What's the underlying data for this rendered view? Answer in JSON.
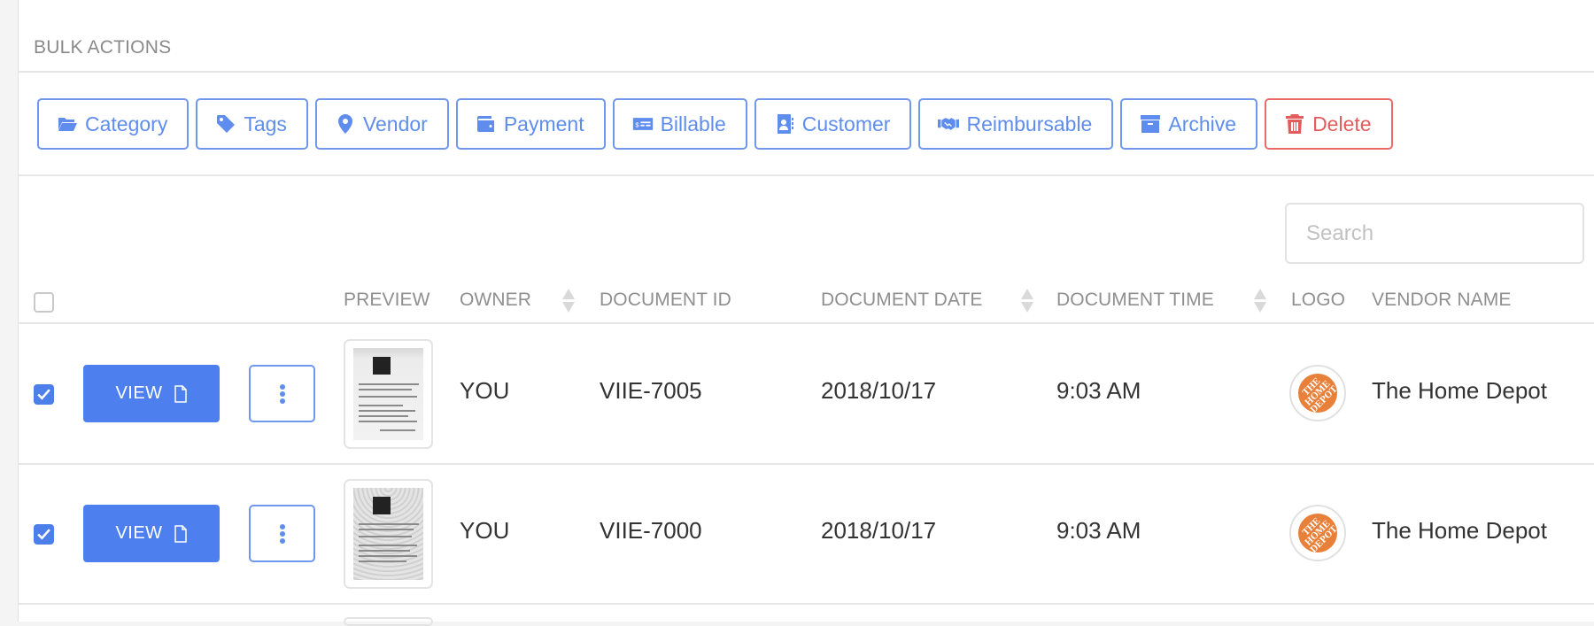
{
  "bulk_actions": {
    "title": "BULK ACTIONS",
    "buttons": [
      {
        "label": "Category",
        "icon": "folder-open-icon"
      },
      {
        "label": "Tags",
        "icon": "tag-icon"
      },
      {
        "label": "Vendor",
        "icon": "map-marker-icon"
      },
      {
        "label": "Payment",
        "icon": "wallet-icon"
      },
      {
        "label": "Billable",
        "icon": "money-check-icon"
      },
      {
        "label": "Customer",
        "icon": "address-book-icon"
      },
      {
        "label": "Reimbursable",
        "icon": "handshake-icon"
      },
      {
        "label": "Archive",
        "icon": "archive-icon"
      },
      {
        "label": "Delete",
        "icon": "trash-icon"
      }
    ]
  },
  "search": {
    "placeholder": "Search",
    "value": ""
  },
  "table": {
    "columns": [
      {
        "label": "PREVIEW",
        "sortable": false
      },
      {
        "label": "OWNER",
        "sortable": true
      },
      {
        "label": "DOCUMENT ID",
        "sortable": false
      },
      {
        "label": "DOCUMENT DATE",
        "sortable": true
      },
      {
        "label": "DOCUMENT TIME",
        "sortable": true
      },
      {
        "label": "LOGO",
        "sortable": false
      },
      {
        "label": "VENDOR NAME",
        "sortable": false
      }
    ],
    "select_all_checked": false,
    "view_label": "VIEW",
    "rows": [
      {
        "checked": true,
        "owner": "YOU",
        "document_id": "VIIE-7005",
        "document_date": "2018/10/17",
        "document_time": "9:03 AM",
        "vendor_logo_text": "THE HOME DEPOT",
        "vendor_name": "The Home Depot"
      },
      {
        "checked": true,
        "owner": "YOU",
        "document_id": "VIIE-7000",
        "document_date": "2018/10/17",
        "document_time": "9:03 AM",
        "vendor_logo_text": "THE HOME DEPOT",
        "vendor_name": "The Home Depot"
      }
    ]
  },
  "colors": {
    "accent": "#4d80ee",
    "outline": "#6f97ee",
    "danger": "#e35c5c",
    "vendor_logo": "#e8803a"
  }
}
